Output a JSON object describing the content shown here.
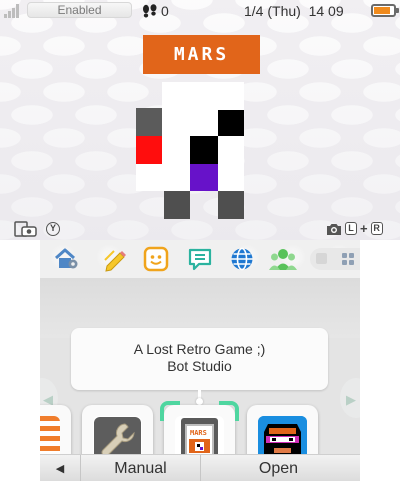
{
  "status_bar": {
    "wifi_label": "Enabled",
    "steps_icon": "footprints-icon",
    "step_count": "0",
    "date": "1/4 (Thu)",
    "time": "14 09",
    "battery_level": 0.85,
    "battery_color": "#f08a1c"
  },
  "top_screen": {
    "banner_title": "MARS",
    "banner_color": "#e1651a",
    "camera_hint_left_key": "Y",
    "camera_hint_right_keys": [
      "L",
      "+",
      "R"
    ]
  },
  "toolbar": {
    "buttons": [
      {
        "name": "settings-house-icon"
      },
      {
        "name": "pencil-notes-icon"
      },
      {
        "name": "smiley-face-icon"
      },
      {
        "name": "chat-bubble-icon"
      },
      {
        "name": "globe-icon"
      },
      {
        "name": "friends-icon"
      }
    ]
  },
  "app_info": {
    "title": "A Lost Retro Game ;)",
    "publisher": "Bot Studio"
  },
  "tiles": [
    {
      "name": "system-settings-tile",
      "icon": "wrench-icon"
    },
    {
      "name": "mars-game-cartridge-tile",
      "icon": "game-cartridge-icon",
      "cartridge_label": "MARS"
    },
    {
      "name": "ninja-face-tile",
      "icon": "ninja-face-icon"
    }
  ],
  "bottom_bar": {
    "back_icon": "triangle-left-icon",
    "manual_label": "Manual",
    "open_label": "Open"
  },
  "colors": {
    "selection_accent": "#4fd6a0",
    "orange_accent": "#e1651a"
  }
}
